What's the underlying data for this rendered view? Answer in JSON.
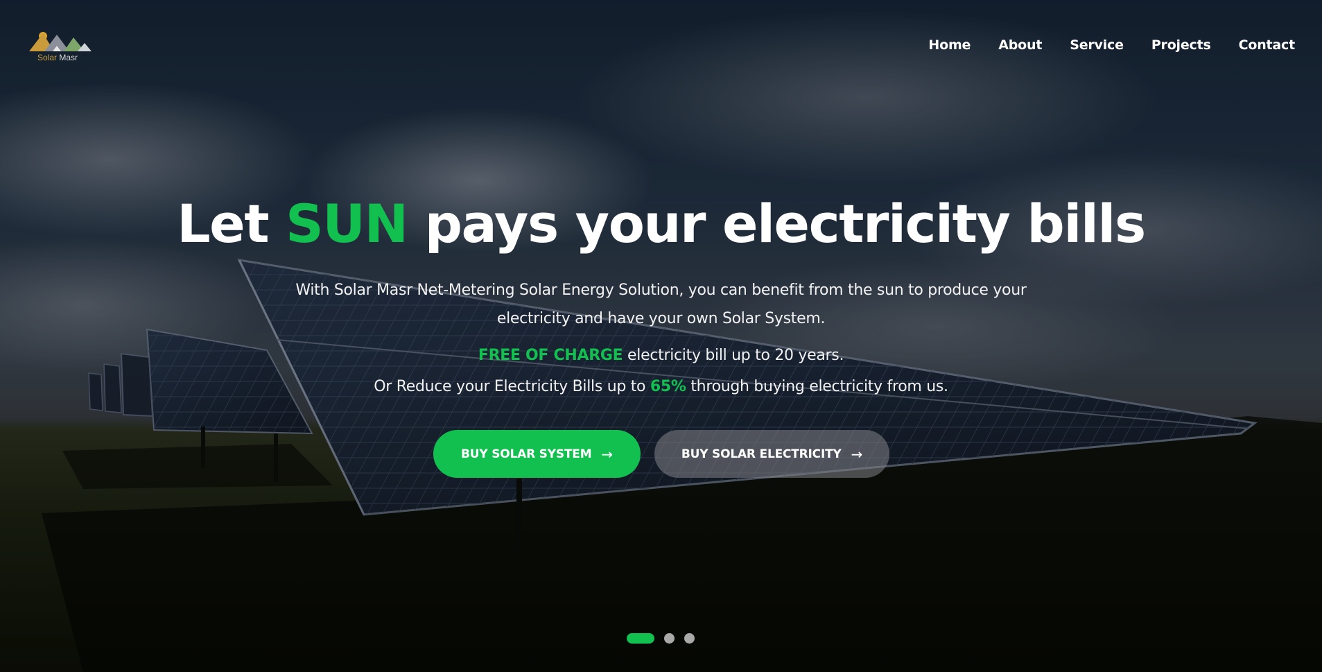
{
  "brand": {
    "logo_text_1": "Solar",
    "logo_text_2": "Masr"
  },
  "nav": [
    {
      "label": "Home"
    },
    {
      "label": "About"
    },
    {
      "label": "Service"
    },
    {
      "label": "Projects"
    },
    {
      "label": "Contact"
    }
  ],
  "hero": {
    "headline_pre": "Let",
    "headline_accent": "SUN",
    "headline_post": "pays your electricity bills",
    "subtitle": "With Solar Masr Net-Metering Solar Energy Solution, you can benefit from the sun to produce your electricity and have your own Solar System.",
    "line3_accent": "FREE OF CHARGE",
    "line3_rest": "electricity bill up to 20 years.",
    "line4_pre": "Or Reduce your Electricity Bills up to",
    "line4_accent": "65%",
    "line4_post": "through buying electricity from us."
  },
  "buttons": {
    "primary_label": "BUY SOLAR SYSTEM",
    "secondary_label": "BUY SOLAR ELECTRICITY",
    "arrow": "→"
  },
  "carousel": {
    "slide_count": 3,
    "active_index": 0
  },
  "colors": {
    "accent": "#12c050"
  }
}
